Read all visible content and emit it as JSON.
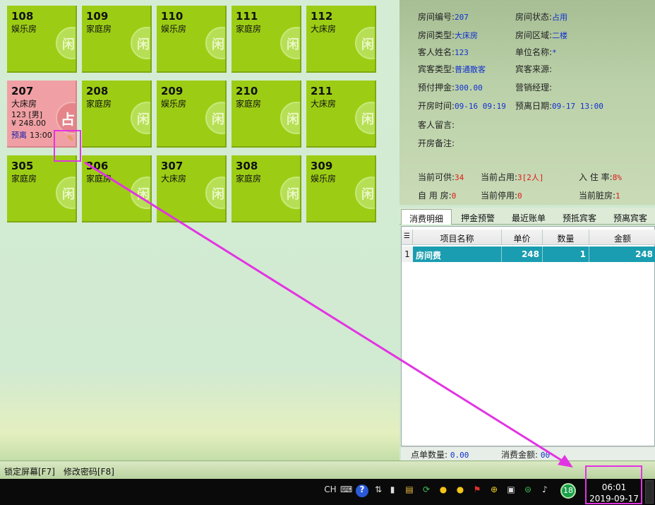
{
  "rooms": {
    "r108": {
      "num": "108",
      "type": "娱乐房",
      "badge": "闲"
    },
    "r109": {
      "num": "109",
      "type": "家庭房",
      "badge": "闲"
    },
    "r110": {
      "num": "110",
      "type": "娱乐房",
      "badge": "闲"
    },
    "r111": {
      "num": "111",
      "type": "家庭房",
      "badge": "闲"
    },
    "r112": {
      "num": "112",
      "type": "大床房",
      "badge": "闲"
    },
    "r207": {
      "num": "207",
      "type": "大床房",
      "badge": "占",
      "guest": "123 [男]",
      "price": "¥ 248.00",
      "leave_label": "预离",
      "leave_time": "13:00"
    },
    "r208": {
      "num": "208",
      "type": "家庭房",
      "badge": "闲"
    },
    "r209": {
      "num": "209",
      "type": "娱乐房",
      "badge": "闲"
    },
    "r210": {
      "num": "210",
      "type": "家庭房",
      "badge": "闲"
    },
    "r211": {
      "num": "211",
      "type": "大床房",
      "badge": "闲"
    },
    "r305": {
      "num": "305",
      "type": "家庭房",
      "badge": "闲"
    },
    "r306": {
      "num": "306",
      "type": "家庭房",
      "badge": "闲"
    },
    "r307": {
      "num": "307",
      "type": "大床房",
      "badge": "闲"
    },
    "r308": {
      "num": "308",
      "type": "家庭房",
      "badge": "闲"
    },
    "r309": {
      "num": "309",
      "type": "娱乐房",
      "badge": "闲"
    }
  },
  "info": {
    "room_no_label": "房间编号:",
    "room_no": "207",
    "room_status_label": "房间状态:",
    "room_status": "占用",
    "room_type_label": "房间类型:",
    "room_type": "大床房",
    "room_area_label": "房间区域:",
    "room_area": "二楼",
    "guest_name_label": "客人姓名:",
    "guest_name": "123",
    "company_label": "单位名称:",
    "company": "*",
    "guest_type_label": "宾客类型:",
    "guest_type": "普通散客",
    "source_label": "宾客来源:",
    "deposit_label": "预付押金:",
    "deposit": "300.00",
    "manager_label": "营销经理:",
    "open_time_label": "开房时间:",
    "open_time": "09-16 09:19",
    "leave_date_label": "预离日期:",
    "leave_date": "09-17 13:00",
    "message_label": "客人留言:",
    "remark_label": "开房备注:"
  },
  "stats": {
    "available_label": "当前可供:",
    "available": "34",
    "occupied_label": "当前占用:",
    "occupied": "3[2人]",
    "occupancy_label": "入 住 率:",
    "occupancy": "8%",
    "self_use_label": "自 用 房:",
    "self_use": "0",
    "stopped_label": "当前停用:",
    "stopped": "0",
    "dirty_label": "当前脏房:",
    "dirty": "1"
  },
  "tabs": [
    "消费明细",
    "押金预警",
    "最近账单",
    "预抵宾客",
    "预离宾客"
  ],
  "table": {
    "headers": [
      "项目名称",
      "单价",
      "数量",
      "金额"
    ],
    "rows": [
      {
        "idx": "1",
        "name": "房间费",
        "price": "248",
        "qty": "1",
        "amount": "248"
      }
    ]
  },
  "footer": {
    "order_count_label": "点单数量:",
    "order_count": "0.00",
    "total_label": "消费金额:",
    "total": "00"
  },
  "status_bar": {
    "lock": "锁定屏幕[F7]",
    "password": "修改密码[F8]"
  },
  "taskbar": {
    "lang": "CH",
    "badge_number": "18",
    "time": "06:01",
    "date": "2019-09-17"
  },
  "colors": {
    "room_free": "#9ccd14",
    "room_occupied": "#f0a0a4",
    "value_blue": "#1030d0",
    "value_red": "#e01818",
    "highlight": "#e234e2",
    "table_selected": "#1a9db0"
  }
}
